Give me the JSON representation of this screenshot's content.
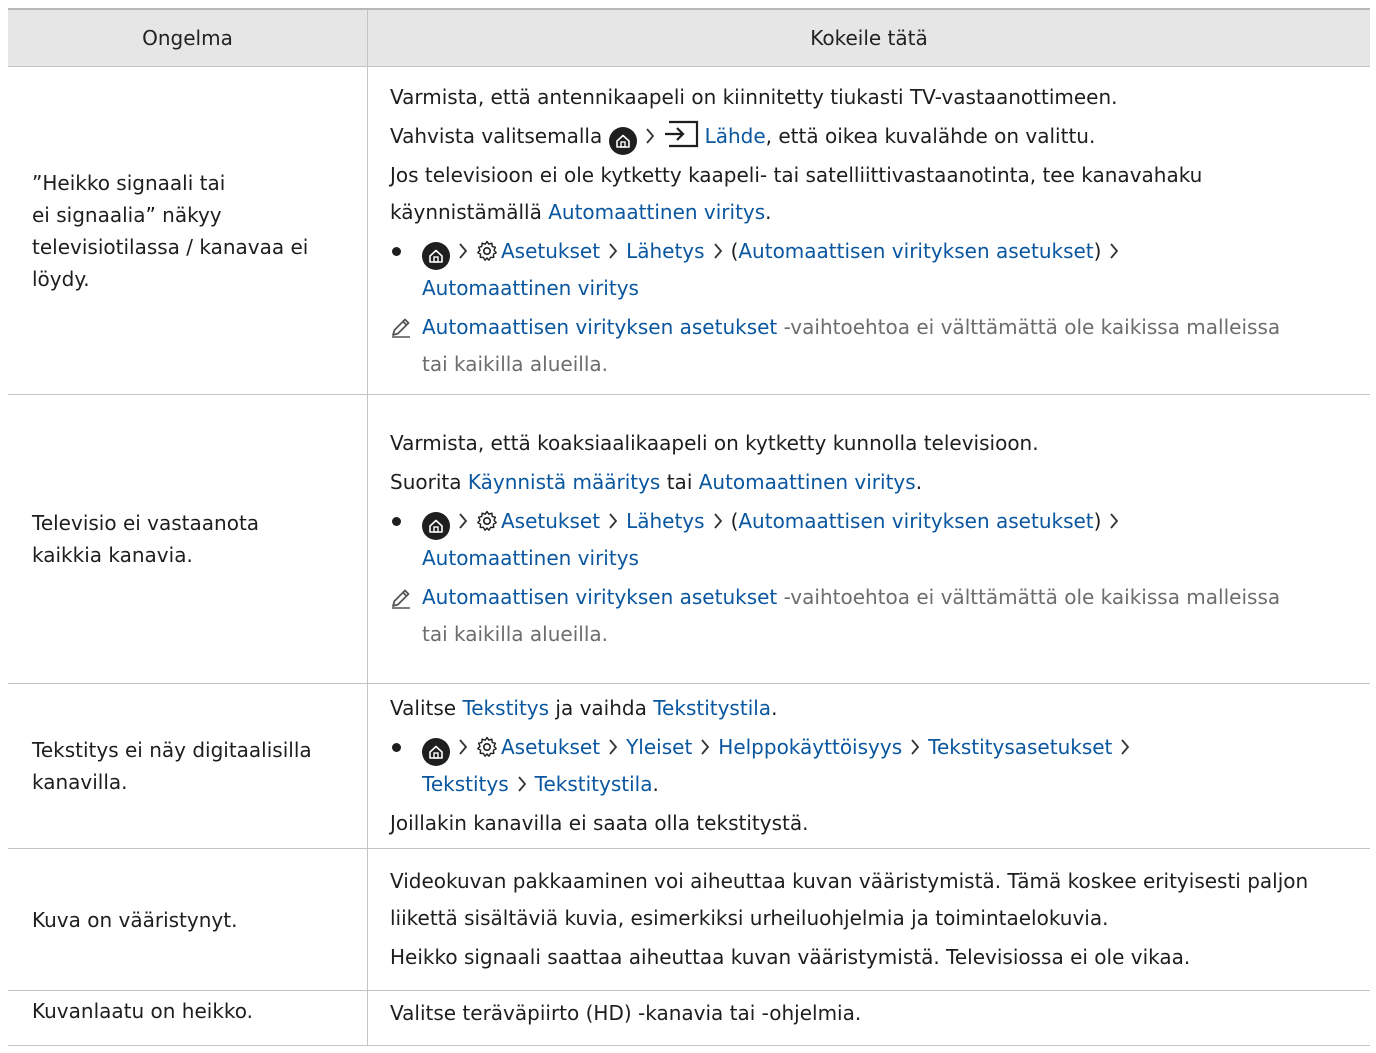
{
  "header": {
    "col_problem": "Ongelma",
    "col_solution": "Kokeile tätä"
  },
  "rows": [
    {
      "problem_lines": [
        "”Heikko signaali tai",
        "ei signaalia” näkyy",
        "televisiotilassa / kanavaa ei",
        "löydy."
      ],
      "p1": "Varmista, että antennikaapeli on kiinnitetty tiukasti TV-vastaanottimeen.",
      "p2_a": "Vahvista valitsemalla",
      "p2_link": "Lähde",
      "p2_b": ", että oikea kuvalähde on valittu.",
      "p3_line1": "Jos televisioon ei ole kytketty kaapeli- tai satelliittivastaanotinta, tee kanavahaku",
      "p3_line2_a": "käynnistämällä",
      "p3_link": "Automaattinen viritys",
      "p3_end": ".",
      "path": {
        "settings": "Asetukset",
        "broadcast": "Lähetys",
        "paren_open": "(",
        "autotune_settings": "Automaattisen virityksen asetukset",
        "paren_close": ")",
        "autotune": "Automaattinen viritys"
      },
      "note_link": "Automaattisen virityksen asetukset",
      "note_line1": " -vaihtoehtoa ei välttämättä ole kaikissa malleissa",
      "note_line2": "tai kaikilla alueilla."
    },
    {
      "problem_lines": [
        "Televisio ei vastaanota",
        "kaikkia kanavia."
      ],
      "p1": "Varmista, että koaksiaalikaapeli on kytketty kunnolla televisioon.",
      "p2_a": "Suorita",
      "p2_link1": "Käynnistä määritys",
      "p2_mid": "tai",
      "p2_link2": "Automaattinen viritys",
      "p2_end": ".",
      "path": {
        "settings": "Asetukset",
        "broadcast": "Lähetys",
        "paren_open": "(",
        "autotune_settings": "Automaattisen virityksen asetukset",
        "paren_close": ")",
        "autotune": "Automaattinen viritys"
      },
      "note_link": "Automaattisen virityksen asetukset",
      "note_line1": " -vaihtoehtoa ei välttämättä ole kaikissa malleissa",
      "note_line2": "tai kaikilla alueilla."
    },
    {
      "problem_lines": [
        "Tekstitys ei näy digitaalisilla",
        "kanavilla."
      ],
      "p1_a": "Valitse",
      "p1_link1": "Tekstitys",
      "p1_mid": "ja vaihda",
      "p1_link2": "Tekstitystila",
      "p1_end": ".",
      "path": {
        "settings": "Asetukset",
        "general": "Yleiset",
        "accessibility": "Helppokäyttöisyys",
        "caption_settings": "Tekstitysasetukset",
        "caption": "Tekstitys",
        "caption_mode": "Tekstitystila",
        "end": "."
      },
      "p2": "Joillakin kanavilla ei saata olla tekstitystä."
    },
    {
      "problem_lines": [
        "Kuva on vääristynyt."
      ],
      "p1_line1": "Videokuvan pakkaaminen voi aiheuttaa kuvan vääristymistä. Tämä koskee erityisesti paljon",
      "p1_line2": "liikettä sisältäviä kuvia, esimerkiksi urheiluohjelmia ja toimintaelokuvia.",
      "p2": "Heikko signaali saattaa aiheuttaa kuvan vääristymistä. Televisiossa ei ole vikaa."
    },
    {
      "problem_lines": [
        "Kuvanlaatu on heikko."
      ],
      "p1": "Valitse teräväpiirto (HD) -kanavia tai -ohjelmia."
    }
  ],
  "icons": {
    "home": "home-icon",
    "chevron": "chevron-right-icon",
    "settings": "gear-icon",
    "source": "source-input-icon",
    "note": "pencil-note-icon"
  },
  "colors": {
    "link": "#0a57a0",
    "note_text": "#6d6d6d",
    "header_bg": "#e6e6e6"
  }
}
